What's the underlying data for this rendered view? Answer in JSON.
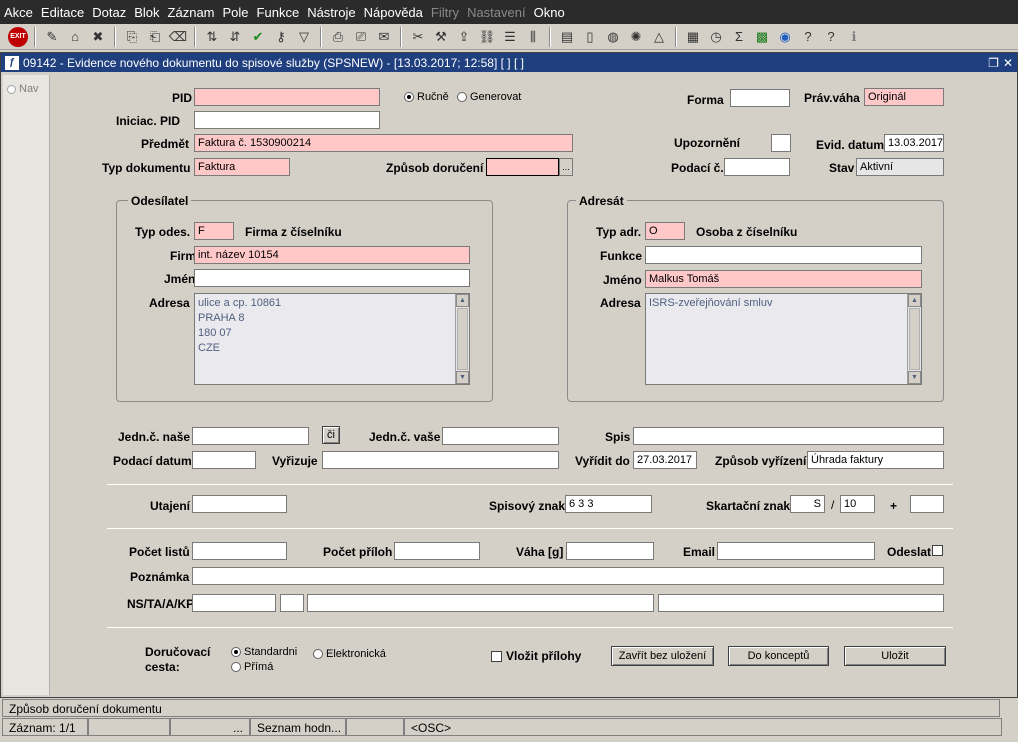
{
  "menu": [
    "Akce",
    "Editace",
    "Dotaz",
    "Blok",
    "Záznam",
    "Pole",
    "Funkce",
    "Nástroje",
    "Nápověda",
    "Filtry",
    "Nastavení",
    "Okno"
  ],
  "menu_disabled": [
    "Filtry",
    "Nastavení"
  ],
  "toolbar": {
    "exit_label": "EXIT"
  },
  "window": {
    "title": "09142 - Evidence nového dokumentu do spisové služby (SPSNEW) - [13.03.2017; 12:58]  [ ] [ ]",
    "nav_label": "Nav"
  },
  "header": {
    "pid_label": "PID",
    "pid_value": "",
    "rucne_label": "Ručně",
    "generovat_label": "Generovat",
    "forma_label": "Forma",
    "forma_value": "",
    "prav_vaha_label": "Práv.váha",
    "prav_vaha_value": "Originál",
    "iniciac_pid_label": "Iniciac. PID",
    "iniciac_pid_value": "",
    "predmet_label": "Předmět",
    "predmet_value": "Faktura č. 1530900214",
    "upozorneni_label": "Upozornění",
    "upozorneni_value": "",
    "evid_datum_label": "Evid. datum",
    "evid_datum_value": "13.03.2017",
    "typ_dokumentu_label": "Typ dokumentu",
    "typ_dokumentu_value": "Faktura",
    "zpusob_doruceni_label": "Způsob doručení",
    "zpusob_doruceni_value": "",
    "lov_label": "...",
    "podaci_c_label": "Podací č.",
    "podaci_c_value": "",
    "stav_label": "Stav",
    "stav_value": "Aktivní"
  },
  "odesilatel": {
    "title": "Odesílatel",
    "typ_label": "Typ odes.",
    "typ_value": "F",
    "typ_desc": "Firma z číselníku",
    "firma_label": "Firma",
    "firma_value": "int. název 10154",
    "jmeno_label": "Jméno",
    "jmeno_value": "",
    "adresa_label": "Adresa",
    "adresa_lines": [
      "ulice a cp. 10861",
      "PRAHA 8",
      "180 07",
      "CZE"
    ]
  },
  "adresat": {
    "title": "Adresát",
    "typ_label": "Typ adr.",
    "typ_value": "O",
    "typ_desc": "Osoba z číselníku",
    "funkce_label": "Funkce",
    "funkce_value": "",
    "jmeno_label": "Jméno",
    "jmeno_value": "Malkus Tomáš",
    "adresa_label": "Adresa",
    "adresa_lines": [
      "ISRS-zveřejňování smluv"
    ]
  },
  "ref": {
    "jedn_nase_label": "Jedn.č. naše",
    "jedn_nase_value": "",
    "ci_button": "či",
    "jedn_vase_label": "Jedn.č. vaše",
    "jedn_vase_value": "",
    "spis_label": "Spis",
    "spis_value": "",
    "podaci_datum_label": "Podací datum",
    "podaci_datum_value": "",
    "vyrizuje_label": "Vyřizuje",
    "vyrizuje_value": "",
    "vyridit_do_label": "Vyřídit do",
    "vyridit_do_value": "27.03.2017",
    "zpusob_vyrizeni_label": "Způsob vyřízení",
    "zpusob_vyrizeni_value": "Úhrada faktury"
  },
  "class": {
    "utajeni_label": "Utajení",
    "utajeni_value": "",
    "spisovy_znak_label": "Spisový znak",
    "spisovy_znak_value": "6 3 3",
    "skartacni_znak_label": "Skartační znak",
    "skartacni_znak_value": "S",
    "slash": "/",
    "skartacni_lhuta_value": "10",
    "plus": "+",
    "plus_value": ""
  },
  "counts": {
    "pocet_listu_label": "Počet listů",
    "pocet_listu_value": "",
    "pocet_priloh_label": "Počet příloh",
    "pocet_priloh_value": "",
    "vaha_label": "Váha [g]",
    "vaha_value": "",
    "email_label": "Email",
    "email_value": "",
    "odeslat_label": "Odeslat",
    "poznamka_label": "Poznámka",
    "poznamka_value": "",
    "ns_label": "NS/TA/A/KP",
    "ns_value1": "",
    "ns_value2": "",
    "ns_value3": "",
    "ns_value4": ""
  },
  "footer": {
    "dorucovaci_label_1": "Doručovací",
    "dorucovaci_label_2": "cesta:",
    "standardni": "Standardni",
    "elektronicka": "Elektronická",
    "prima": "Přímá",
    "vlozit_prilohy": "Vložit přílohy",
    "zavrit_button": "Zavřít bez uložení",
    "do_konceptu_button": "Do konceptů",
    "ulozit_button": "Uložit"
  },
  "status": {
    "message": "Způsob doručení dokumentu",
    "zaznam": "Záznam: 1/1",
    "cell2": "",
    "cell3": "...",
    "seznam": "Seznam hodn...",
    "cell5": "",
    "osc": "<OSC>"
  }
}
